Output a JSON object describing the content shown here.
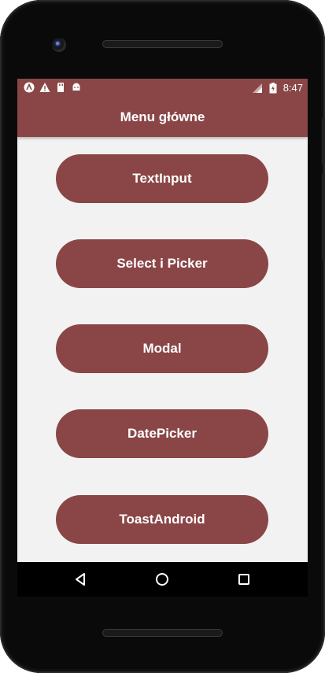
{
  "status_bar": {
    "time": "8:47",
    "left_icons": [
      "app-a-icon",
      "warning-icon",
      "sd-card-icon",
      "android-icon"
    ],
    "right_icons": [
      "signal-icon",
      "battery-icon"
    ]
  },
  "app_bar": {
    "title": "Menu główne"
  },
  "menu": {
    "items": [
      {
        "label": "TextInput"
      },
      {
        "label": "Select i Picker"
      },
      {
        "label": "Modal"
      },
      {
        "label": "DatePicker"
      },
      {
        "label": "ToastAndroid"
      }
    ]
  },
  "nav_bar": {
    "buttons": [
      "back-icon",
      "home-icon",
      "recents-icon"
    ]
  },
  "colors": {
    "accent": "#8a4646",
    "background": "#f2f2f2",
    "text_on_accent": "#ffffff"
  }
}
